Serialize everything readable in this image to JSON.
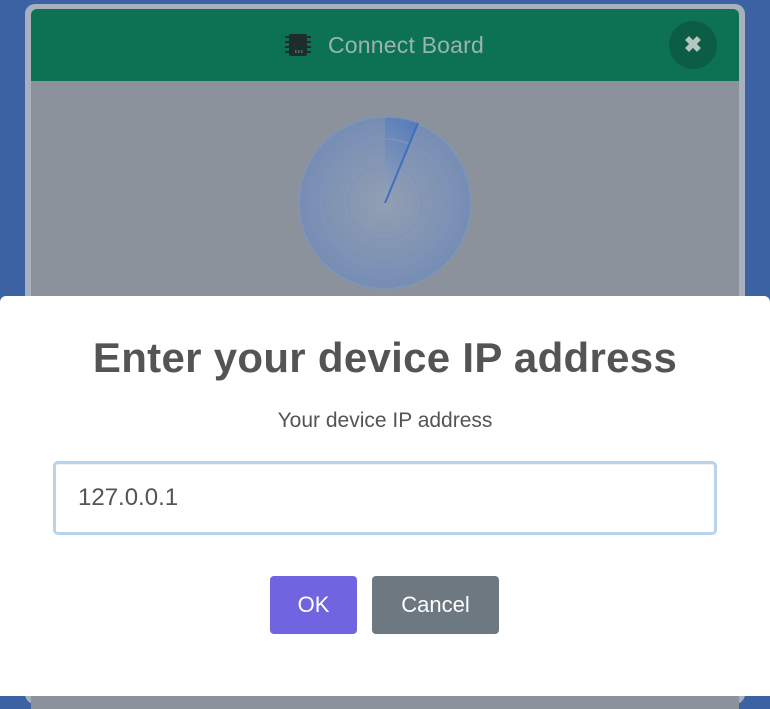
{
  "connect_board": {
    "title": "Connect Board",
    "close_symbol": "✖",
    "icons": {
      "board": "chip-icon",
      "close": "close-icon",
      "scanner": "radar-scan-icon"
    },
    "colors": {
      "header": "#0c7251",
      "body": "#8c929b",
      "radar": "#5b7fbd"
    }
  },
  "prompt": {
    "title": "Enter your device IP address",
    "label": "Your device IP address",
    "ip_value": "127.0.0.1",
    "ok_label": "OK",
    "cancel_label": "Cancel",
    "colors": {
      "ok": "#7064e0",
      "cancel": "#6e7881",
      "input_focus": "#b9d3ea"
    }
  }
}
